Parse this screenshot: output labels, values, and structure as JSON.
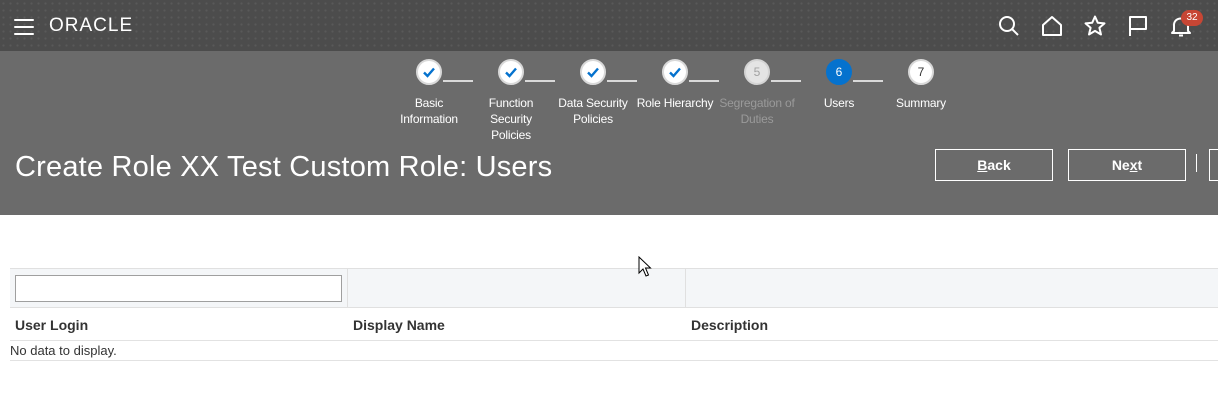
{
  "brand": {
    "logo_text": "ORACLE"
  },
  "topbar": {
    "icons": [
      "search-icon",
      "home-icon",
      "favorites-star-icon",
      "flag-icon",
      "notifications-bell-icon"
    ],
    "notifications_count": "32",
    "badge_color": "#c74634"
  },
  "train": {
    "steps": [
      {
        "number": "1",
        "label_line1": "Basic",
        "label_line2": "Information",
        "state": "completed"
      },
      {
        "number": "2",
        "label_line1": "Function",
        "label_line2": "Security Policies",
        "state": "completed"
      },
      {
        "number": "3",
        "label_line1": "Data Security",
        "label_line2": "Policies",
        "state": "completed"
      },
      {
        "number": "4",
        "label_line1": "Role Hierarchy",
        "label_line2": "",
        "state": "completed"
      },
      {
        "number": "5",
        "label_line1": "Segregation of",
        "label_line2": "Duties",
        "state": "disabled"
      },
      {
        "number": "6",
        "label_line1": "Users",
        "label_line2": "",
        "state": "current"
      },
      {
        "number": "7",
        "label_line1": "Summary",
        "label_line2": "",
        "state": "future"
      }
    ],
    "current_color": "#0572ce"
  },
  "page": {
    "title": "Create Role XX Test Custom Role: Users",
    "back_button": {
      "pre": "",
      "key": "B",
      "post": "ack"
    },
    "next_button": {
      "pre": "Ne",
      "key": "x",
      "post": "t"
    }
  },
  "table": {
    "filter": {
      "value": "",
      "placeholder": ""
    },
    "columns": [
      "User Login",
      "Display Name",
      "Description"
    ],
    "empty_message": "No data to display."
  }
}
